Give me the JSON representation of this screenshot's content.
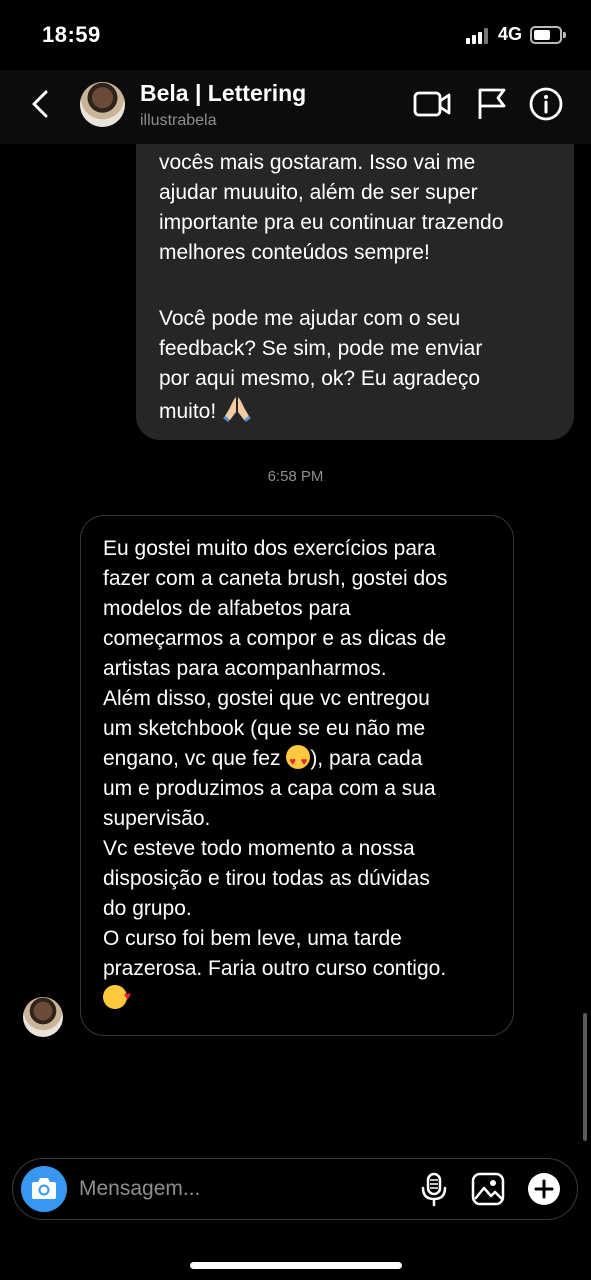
{
  "status_bar": {
    "time": "18:59",
    "network": "4G"
  },
  "header": {
    "name": "Bela | Lettering",
    "username": "illustrabela"
  },
  "messages": {
    "outgoing": {
      "paragraph1": "vocês mais gostaram. Isso vai me\najudar muuuito, além de ser super\nimportante pra eu continuar trazendo\nmelhores conteúdos sempre!",
      "paragraph2": "Você pode me ajudar com o seu\nfeedback? Se sim, pode me enviar\npor aqui mesmo, ok? Eu agradeço\nmuito! ",
      "paragraph2_emoji": "folded-hands-emoji"
    },
    "timestamp": "6:58 PM",
    "incoming": {
      "paragraph1": "Eu gostei muito dos exercícios para\nfazer com a caneta brush, gostei dos\nmodelos de alfabetos para\ncomeçarmos a compor e as dicas de\nartistas para acompanharmos.",
      "paragraph2_part1": "Além disso, gostei que vc entregou\num sketchbook (que se eu não me\nengano, vc que fez ",
      "paragraph2_emoji": "heart-eyes-emoji",
      "paragraph2_part2": "), para cada\num e produzimos a capa com a sua\nsupervisão.",
      "paragraph3": "Vc esteve todo momento a nossa\ndisposição e tirou todas as dúvidas\ndo grupo.",
      "paragraph4": "O curso foi bem leve, uma tarde\nprazerosa. Faria outro curso contigo.",
      "paragraph4_emoji": "kissing-heart-emoji"
    }
  },
  "composer": {
    "placeholder": "Mensagem..."
  },
  "colors": {
    "background": "#000000",
    "outgoing_bubble": "#262626",
    "camera_button": "#3897f0",
    "secondary_text": "#8e8e8e"
  }
}
